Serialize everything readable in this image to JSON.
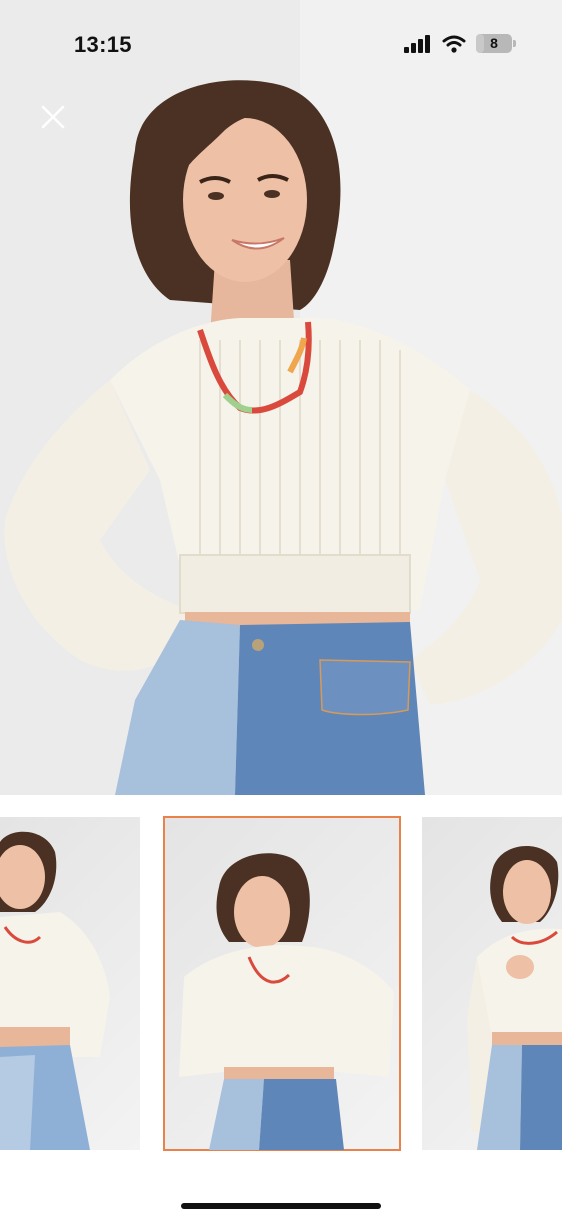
{
  "status_bar": {
    "time": "13:15",
    "battery_level": "8",
    "icons": [
      "signal-icon",
      "wifi-icon",
      "battery-icon"
    ]
  },
  "viewer": {
    "close_icon": "close-icon",
    "main_image": "model-white-cropped-sweater-front",
    "selected_index": 1
  },
  "thumbnails": [
    {
      "image": "model-sweater-left-angle",
      "selected": false
    },
    {
      "image": "model-sweater-front",
      "selected": true
    },
    {
      "image": "model-sweater-hand-on-neck",
      "selected": false
    }
  ],
  "colors": {
    "selected_outline": "#e8824a",
    "sweater": "#f6f3ea",
    "denim_light": "#a7c0dc",
    "denim_dark": "#5f86b8",
    "hair": "#4a3123"
  }
}
